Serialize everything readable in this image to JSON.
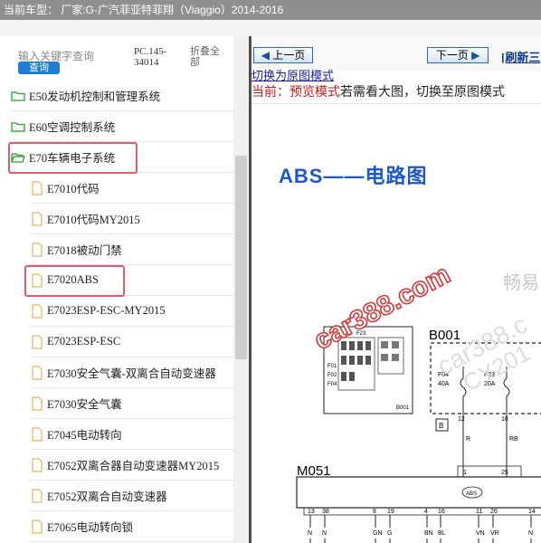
{
  "header": {
    "vehicle_label": "当前车型： 厂家:G-广汽菲亚特菲翔（Viaggio）2014-2016"
  },
  "sidebar": {
    "search_placeholder": "输入关键字查询",
    "search_button": "查询",
    "pc_code": "PC.145-34014",
    "collapse_all": "折叠全部",
    "folders": [
      {
        "label": "E50发动机控制和管理系统"
      },
      {
        "label": "E60空调控制系统"
      },
      {
        "label": "E70车辆电子系统"
      }
    ],
    "files": [
      {
        "label": "E7010代码"
      },
      {
        "label": "E7010代码MY2015"
      },
      {
        "label": "E7018被动门禁"
      },
      {
        "label": "E7020ABS"
      },
      {
        "label": "E7023ESP-ESC-MY2015"
      },
      {
        "label": "E7023ESP-ESC"
      },
      {
        "label": "E7030安全气囊-双离合自动变速器"
      },
      {
        "label": "E7030安全气囊"
      },
      {
        "label": "E7045电动转向"
      },
      {
        "label": "E7052双离合器自动变速器MY2015"
      },
      {
        "label": "E7052双离合自动变速器"
      },
      {
        "label": "E7065电动转向锁"
      }
    ],
    "highlighted": [
      "E70车辆电子系统",
      "E7020ABS"
    ]
  },
  "content": {
    "prev_button": "上一页",
    "next_button": "下一页",
    "refresh_link": "[刷新三",
    "switch_link": "切换为原图模式",
    "mode_current": "当前：预览模式",
    "mode_hint": "若需看大图，切换至原图模式",
    "diagram_title": "ABS——电路图",
    "watermark_1": "car388.com",
    "watermark_2": "畅易",
    "watermark_3": "car388.c",
    "watermark_4": "CY201",
    "components": {
      "b001": "B001",
      "b001_small": "B001",
      "m051": "M051",
      "abs_chip": "ABS",
      "ground_b": "B",
      "f23": "F23",
      "fuse_f04": "F04",
      "fuse_f04_rating": "40A",
      "fuse_f23": "F23",
      "fuse_f23_rating": "20A",
      "fuse_box_labels": [
        "F01",
        "F02",
        "F04"
      ]
    },
    "wires": {
      "pin_12": "12",
      "pin_16": "16",
      "wire_r": "R",
      "wire_rb": "RB",
      "pin_1": "1",
      "pin_25": "25",
      "bottom_pins": [
        "13",
        "38",
        "8",
        "19",
        "4",
        "16",
        "11",
        "26",
        "14"
      ],
      "bottom_wires": [
        "N",
        "N",
        "GN",
        "G",
        "BN",
        "BL",
        "VN",
        "VR",
        "N"
      ]
    }
  },
  "colors": {
    "header_bg": "#8f8f91",
    "highlight_border": "#e05a6a",
    "title_blue": "#1e57c8",
    "watermark_red": "#d23a3a",
    "mode_red": "#d8141b",
    "folder_green": "#2e9a2e",
    "file_tan": "#e2b46a"
  }
}
